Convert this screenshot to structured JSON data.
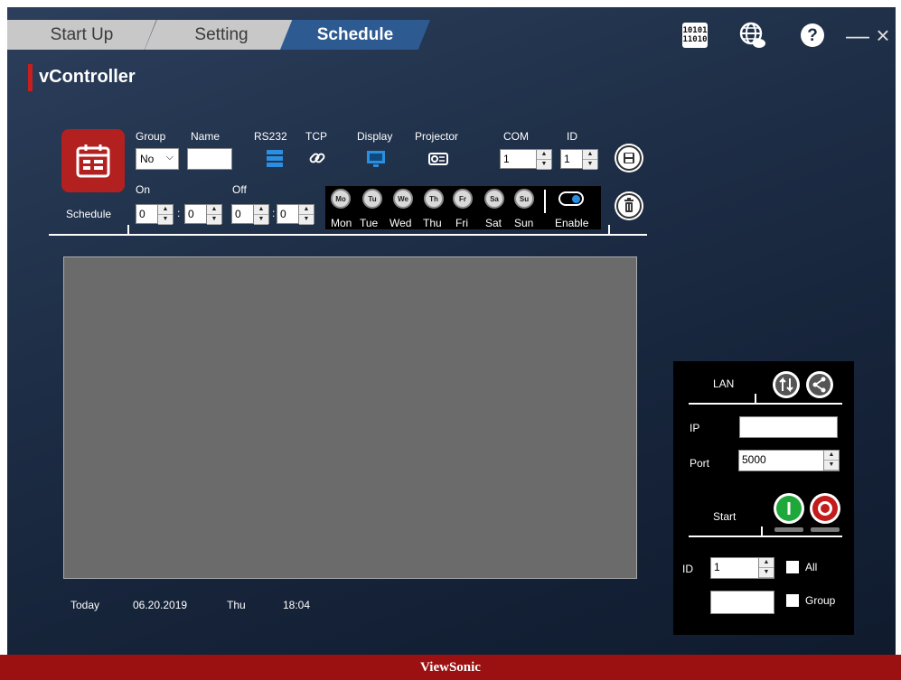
{
  "tabs": [
    {
      "label": "Start Up",
      "active": false
    },
    {
      "label": "Setting",
      "active": false
    },
    {
      "label": "Schedule",
      "active": true
    }
  ],
  "app_title": "vController",
  "toolbar": {
    "binary_icon_text": "10101\n11010",
    "close_glyph": "×",
    "minimize_glyph": "—"
  },
  "schedule": {
    "button_label": "Schedule",
    "group_label": "Group",
    "group_value": "No",
    "name_label": "Name",
    "name_value": "",
    "rs232_label": "RS232",
    "tcp_label": "TCP",
    "display_label": "Display",
    "projector_label": "Projector",
    "com_label": "COM",
    "com_value": "1",
    "id_label": "ID",
    "id_value": "1",
    "on_label": "On",
    "off_label": "Off",
    "on_hour": "0",
    "on_min": "0",
    "off_hour": "0",
    "off_min": "0",
    "colon": ":",
    "days": [
      {
        "abbr": "Mo",
        "label": "Mon"
      },
      {
        "abbr": "Tu",
        "label": "Tue"
      },
      {
        "abbr": "We",
        "label": "Wed"
      },
      {
        "abbr": "Th",
        "label": "Thu"
      },
      {
        "abbr": "Fr",
        "label": "Fri"
      },
      {
        "abbr": "Sa",
        "label": "Sat"
      },
      {
        "abbr": "Su",
        "label": "Sun"
      }
    ],
    "enable_label": "Enable",
    "enabled": true
  },
  "status": {
    "today_label": "Today",
    "date": "06.20.2019",
    "weekday": "Thu",
    "time": "18:04"
  },
  "lan": {
    "title": "LAN",
    "ip_label": "IP",
    "ip_value": "",
    "port_label": "Port",
    "port_value": "5000",
    "start_label": "Start",
    "id_label": "ID",
    "id_value": "1",
    "all_label": "All",
    "group_label": "Group",
    "group_value": ""
  },
  "brand": "ViewSonic",
  "colors": {
    "accent_red": "#b32020",
    "tab_active": "#2d5a91",
    "icon_blue": "#2a8fe0",
    "start_green": "#1fa83a",
    "stop_red": "#c21c1c"
  }
}
